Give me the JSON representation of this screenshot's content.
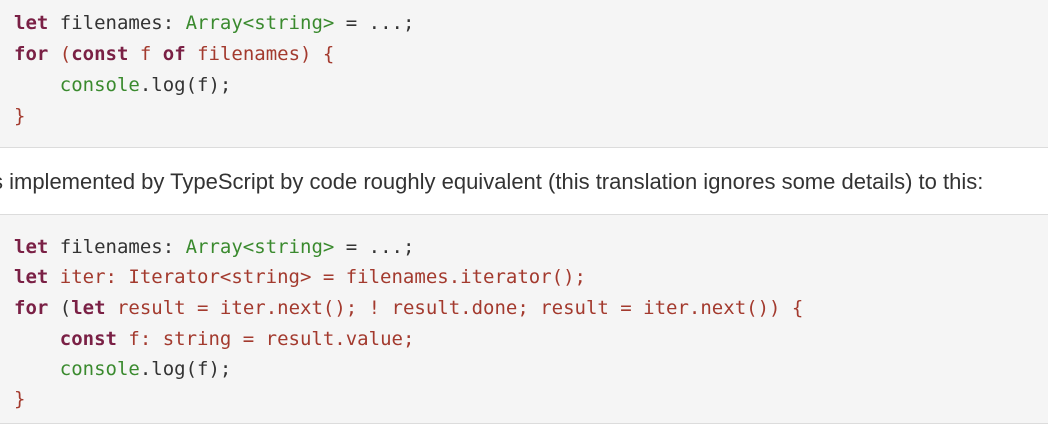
{
  "code_block_1": {
    "lines": [
      [
        "let",
        " filenames: ",
        "Array<string>",
        " = ...;"
      ],
      [
        "for",
        " ",
        "(",
        "const",
        " f ",
        "of",
        " filenames) {"
      ],
      [
        "    ",
        "console",
        ".log(f);"
      ],
      [
        "}"
      ]
    ]
  },
  "prose": {
    "text": "s implemented by TypeScript by code roughly equivalent (this translation ignores some details) to this:"
  },
  "code_block_2": {
    "lines": [
      [
        "let",
        " filenames: ",
        "Array<string>",
        " = ...;"
      ],
      [
        "let",
        " iter: Iterator<string> = filenames.iterator();"
      ],
      [
        "for",
        " (",
        "let",
        " result = iter.next(); ! result.done; result = iter.next()) {"
      ],
      [
        "    ",
        "const",
        " f: string = result.value;"
      ],
      [
        "    ",
        "console",
        ".log(f);"
      ],
      [
        "}"
      ]
    ]
  },
  "colors": {
    "keyword": "#7a2045",
    "type": "#3a8a2e",
    "expr": "#a33a2e",
    "text": "#333333",
    "code_bg": "#f5f5f5"
  }
}
